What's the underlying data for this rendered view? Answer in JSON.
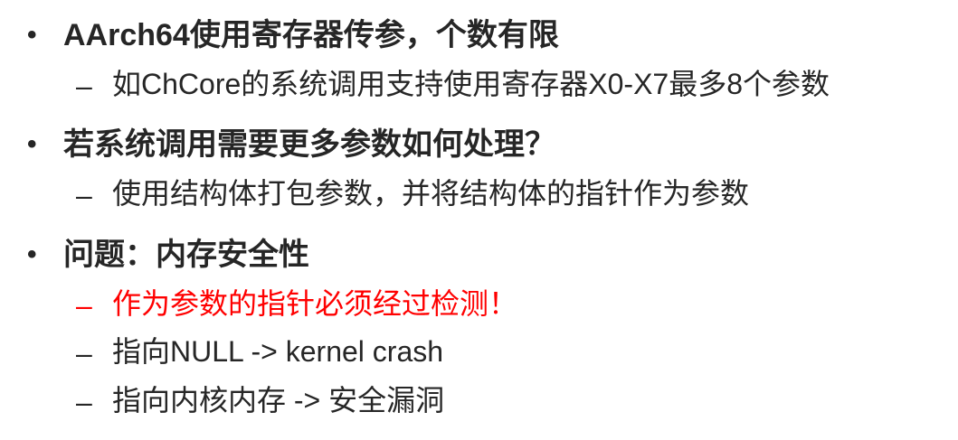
{
  "items": [
    {
      "bullet": "•",
      "text": "AArch64使用寄存器传参，个数有限",
      "subitems": [
        {
          "dash": "–",
          "text": "如ChCore的系统调用支持使用寄存器X0-X7最多8个参数"
        }
      ]
    },
    {
      "bullet": "•",
      "text": "若系统调用需要更多参数如何处理？",
      "subitems": [
        {
          "dash": "–",
          "text": "使用结构体打包参数，并将结构体的指针作为参数"
        }
      ]
    },
    {
      "bullet": "•",
      "text": "问题：内存安全性",
      "subitems": [
        {
          "dash": "–",
          "text": "作为参数的指针必须经过检测！"
        },
        {
          "dash": "–",
          "text": "指向NULL -> kernel crash"
        },
        {
          "dash": "–",
          "text": "指向内核内存 -> 安全漏洞"
        }
      ]
    }
  ],
  "colors": {
    "text": "#262626",
    "highlight": "#ff0000",
    "background": "#ffffff"
  }
}
